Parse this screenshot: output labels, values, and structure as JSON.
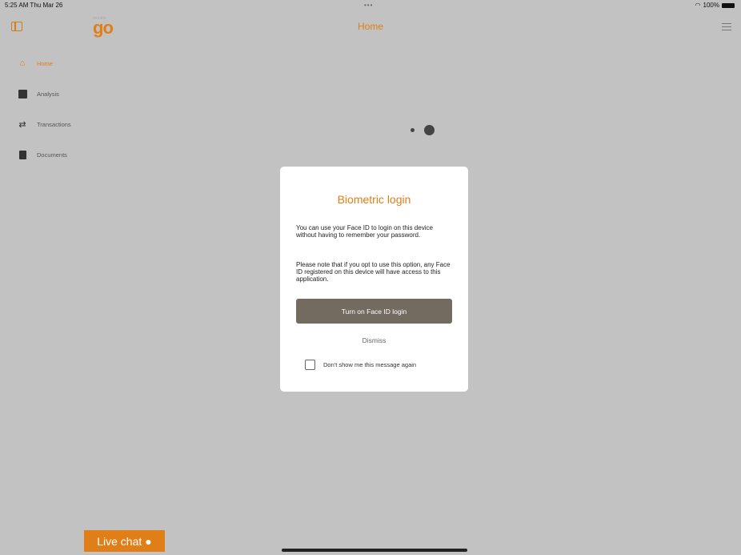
{
  "status_bar": {
    "time": "5:25 AM  Thu Mar 26",
    "dots": "•••",
    "battery": "100%"
  },
  "header": {
    "logo_small": "moneta",
    "logo": "go",
    "title": "Home"
  },
  "sidebar": {
    "items": [
      {
        "label": "Home",
        "icon": "home-icon",
        "active": true
      },
      {
        "label": "Analysis",
        "icon": "chart-icon"
      },
      {
        "label": "Transactions",
        "icon": "transfer-icon"
      },
      {
        "label": "Documents",
        "icon": "document-icon"
      }
    ]
  },
  "modal": {
    "title": "Biometric login",
    "paragraph1": "You can use your Face ID to login on this device without having to remember your password.",
    "paragraph2": "Please note that if you opt to use this option, any Face ID registered on this device will have access to this application.",
    "primary_button": "Turn on Face ID login",
    "dismiss": "Dismiss",
    "checkbox_label": "Don't show me this message again"
  },
  "live_chat": {
    "label": "Live chat"
  },
  "colors": {
    "accent": "#e07e17",
    "button": "#736a60",
    "overlay": "#c2c2c2"
  }
}
